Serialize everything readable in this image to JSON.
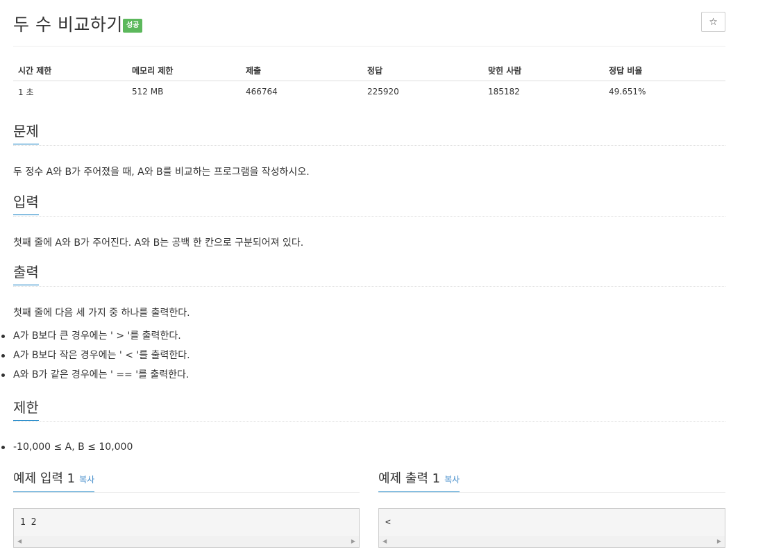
{
  "header": {
    "title": "두 수 비교하기",
    "badge": "성공",
    "star_icon": "☆"
  },
  "stats": {
    "headers": [
      "시간 제한",
      "메모리 제한",
      "제출",
      "정답",
      "맞힌 사람",
      "정답 비율"
    ],
    "values": [
      "1 초",
      "512 MB",
      "466764",
      "225920",
      "185182",
      "49.651%"
    ]
  },
  "problem": {
    "heading": "문제",
    "text": "두 정수 A와 B가 주어졌을 때, A와 B를 비교하는 프로그램을 작성하시오."
  },
  "input": {
    "heading": "입력",
    "text": "첫째 줄에 A와 B가 주어진다. A와 B는 공백 한 칸으로 구분되어져 있다."
  },
  "output": {
    "heading": "출력",
    "text": "첫째 줄에 다음 세 가지 중 하나를 출력한다.",
    "items": [
      "A가 B보다 큰 경우에는 ' > '를 출력한다.",
      "A가 B보다 작은 경우에는 ' < '를 출력한다.",
      "A와 B가 같은 경우에는 ' == '를 출력한다."
    ]
  },
  "limit": {
    "heading": "제한",
    "items": [
      "-10,000 ≤ A, B ≤ 10,000"
    ]
  },
  "sample_input": {
    "heading": "예제 입력 1",
    "copy": "복사",
    "content": "1 2"
  },
  "sample_output": {
    "heading": "예제 출력 1",
    "copy": "복사",
    "content": "<"
  },
  "colors": {
    "accent": "#0076c0",
    "badge": "#5cb85c",
    "link": "#428bca"
  }
}
